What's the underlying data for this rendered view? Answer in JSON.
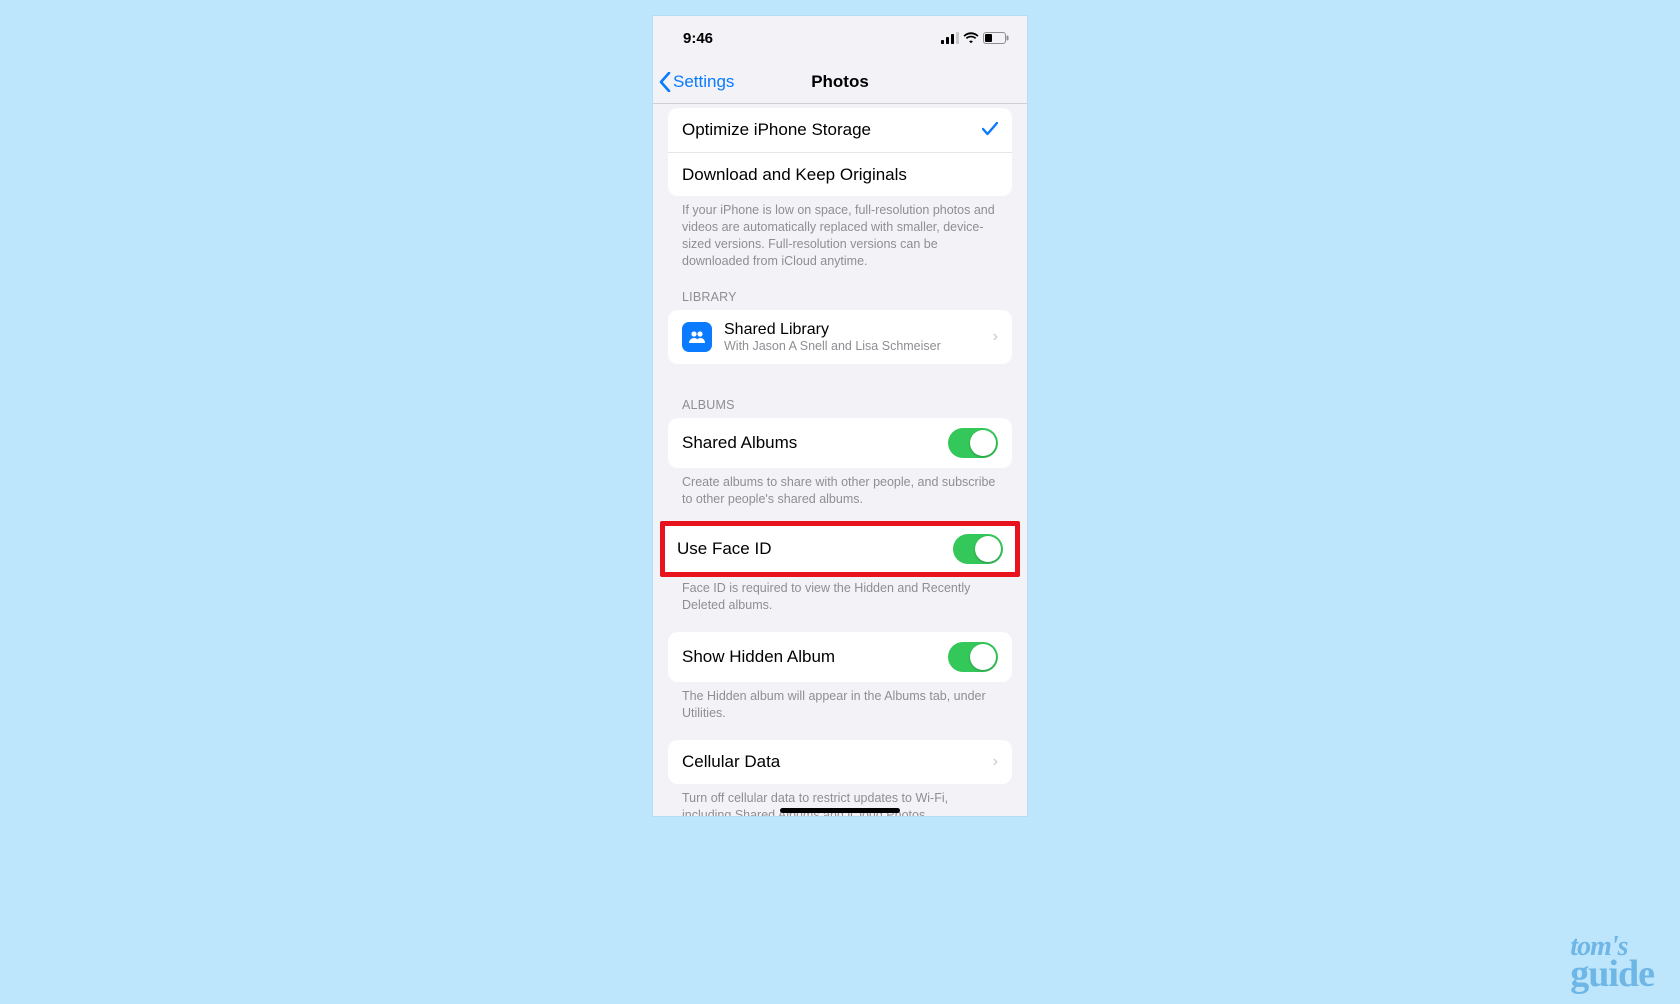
{
  "statusbar": {
    "time": "9:46"
  },
  "nav": {
    "back": "Settings",
    "title": "Photos"
  },
  "storage": {
    "optimize": "Optimize iPhone Storage",
    "download": "Download and Keep Originals",
    "footer": "If your iPhone is low on space, full-resolution photos and videos are automatically replaced with smaller, device-sized versions. Full-resolution versions can be downloaded from iCloud anytime."
  },
  "library": {
    "header": "LIBRARY",
    "shared_title": "Shared Library",
    "shared_sub": "With Jason A Snell and Lisa Schmeiser"
  },
  "albums": {
    "header": "ALBUMS",
    "shared_albums": "Shared Albums",
    "shared_footer": "Create albums to share with other people, and subscribe to other people's shared albums.",
    "use_faceid": "Use Face ID",
    "faceid_footer": "Face ID is required to view the Hidden and Recently Deleted albums.",
    "show_hidden": "Show Hidden Album",
    "hidden_footer": "The Hidden album will appear in the Albums tab, under Utilities.",
    "cellular": "Cellular Data",
    "cellular_footer": "Turn off cellular data to restrict updates to Wi-Fi, including Shared Albums and iCloud Photos."
  },
  "watermark": {
    "top": "tom's",
    "bottom": "guide"
  }
}
